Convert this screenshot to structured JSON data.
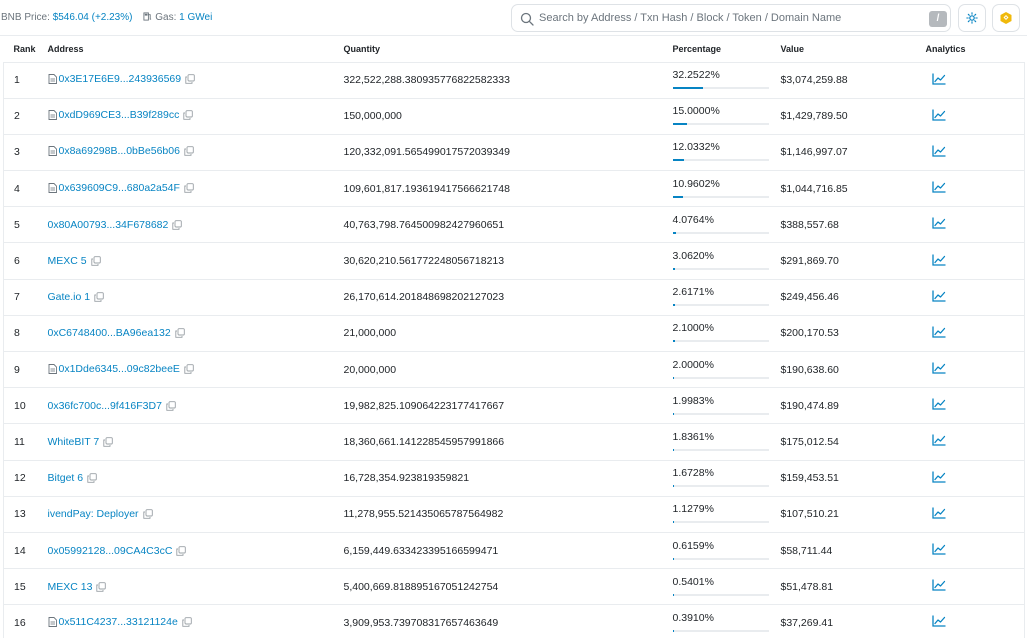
{
  "header": {
    "bnb_price_label": "BNB Price:",
    "bnb_price_value": "$546.04 (+2.23%)",
    "gas_label": "Gas:",
    "gas_value": "1 GWei"
  },
  "search": {
    "placeholder": "Search by Address / Txn Hash / Block / Token / Domain Name",
    "shortcut_key": "/"
  },
  "icons": {
    "search": "search-icon",
    "theme": "sun-icon",
    "network": "bnb-logo-icon",
    "gas": "gas-pump-icon",
    "contract": "file-contract-icon",
    "copy": "copy-icon",
    "analytics": "chart-line-icon"
  },
  "colors": {
    "link": "#0784c3",
    "bnb": "#f0b90b",
    "border": "#e9ecef"
  },
  "table": {
    "columns": [
      "Rank",
      "Address",
      "Quantity",
      "Percentage",
      "Value",
      "Analytics"
    ],
    "rows": [
      {
        "rank": "1",
        "address": "0x3E17E6E9...243936569",
        "contract": true,
        "quantity": "322,522,288.380935776822582333",
        "percentage": "32.2522%",
        "pct": 0.322522,
        "value": "$3,074,259.88"
      },
      {
        "rank": "2",
        "address": "0xdD969CE3...B39f289cc",
        "contract": true,
        "quantity": "150,000,000",
        "percentage": "15.0000%",
        "pct": 0.15,
        "value": "$1,429,789.50"
      },
      {
        "rank": "3",
        "address": "0x8a69298B...0bBe56b06",
        "contract": true,
        "quantity": "120,332,091.565499017572039349",
        "percentage": "12.0332%",
        "pct": 0.120332,
        "value": "$1,146,997.07"
      },
      {
        "rank": "4",
        "address": "0x639609C9...680a2a54F",
        "contract": true,
        "quantity": "109,601,817.193619417566621748",
        "percentage": "10.9602%",
        "pct": 0.109602,
        "value": "$1,044,716.85"
      },
      {
        "rank": "5",
        "address": "0x80A00793...34F678682",
        "contract": false,
        "quantity": "40,763,798.764500982427960651",
        "percentage": "4.0764%",
        "pct": 0.040764,
        "value": "$388,557.68"
      },
      {
        "rank": "6",
        "address": "MEXC 5",
        "contract": false,
        "quantity": "30,620,210.561772248056718213",
        "percentage": "3.0620%",
        "pct": 0.03062,
        "value": "$291,869.70"
      },
      {
        "rank": "7",
        "address": "Gate.io 1",
        "contract": false,
        "quantity": "26,170,614.201848698202127023",
        "percentage": "2.6171%",
        "pct": 0.026171,
        "value": "$249,456.46"
      },
      {
        "rank": "8",
        "address": "0xC6748400...BA96ea132",
        "contract": false,
        "quantity": "21,000,000",
        "percentage": "2.1000%",
        "pct": 0.021,
        "value": "$200,170.53"
      },
      {
        "rank": "9",
        "address": "0x1Dde6345...09c82beeE",
        "contract": true,
        "quantity": "20,000,000",
        "percentage": "2.0000%",
        "pct": 0.02,
        "value": "$190,638.60"
      },
      {
        "rank": "10",
        "address": "0x36fc700c...9f416F3D7",
        "contract": false,
        "quantity": "19,982,825.109064223177417667",
        "percentage": "1.9983%",
        "pct": 0.019983,
        "value": "$190,474.89"
      },
      {
        "rank": "11",
        "address": "WhiteBIT 7",
        "contract": false,
        "quantity": "18,360,661.141228545957991866",
        "percentage": "1.8361%",
        "pct": 0.018361,
        "value": "$175,012.54"
      },
      {
        "rank": "12",
        "address": "Bitget 6",
        "contract": false,
        "quantity": "16,728,354.923819359821",
        "percentage": "1.6728%",
        "pct": 0.016728,
        "value": "$159,453.51"
      },
      {
        "rank": "13",
        "address": "ivendPay: Deployer",
        "contract": false,
        "quantity": "11,278,955.521435065787564982",
        "percentage": "1.1279%",
        "pct": 0.011279,
        "value": "$107,510.21"
      },
      {
        "rank": "14",
        "address": "0x05992128...09CA4C3cC",
        "contract": false,
        "quantity": "6,159,449.633423395166599471",
        "percentage": "0.6159%",
        "pct": 0.006159,
        "value": "$58,711.44"
      },
      {
        "rank": "15",
        "address": "MEXC 13",
        "contract": false,
        "quantity": "5,400,669.818895167051242754",
        "percentage": "0.5401%",
        "pct": 0.005401,
        "value": "$51,478.81"
      },
      {
        "rank": "16",
        "address": "0x511C4237...33121124e",
        "contract": true,
        "quantity": "3,909,953.739708317657463649",
        "percentage": "0.3910%",
        "pct": 0.00391,
        "value": "$37,269.41"
      }
    ]
  }
}
